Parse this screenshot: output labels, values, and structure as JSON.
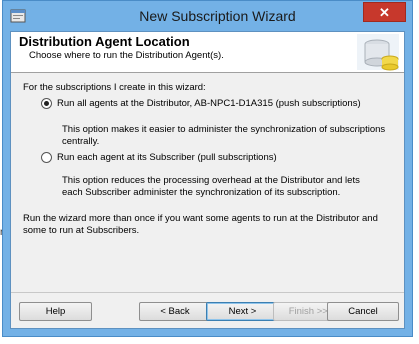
{
  "window": {
    "title": "New Subscription Wizard",
    "close_label": "✕"
  },
  "header": {
    "title": "Distribution Agent Location",
    "subtitle": "Choose where to run the Distribution Agent(s)."
  },
  "main": {
    "prompt": "For the subscriptions I create in this wizard:",
    "options": [
      {
        "label": "Run all agents at the Distributor, AB-NPC1-D1A315 (push subscriptions)",
        "selected": true,
        "description": "This option makes it easier to administer the synchronization of subscriptions centrally."
      },
      {
        "label": "Run each agent at its Subscriber (pull subscriptions)",
        "selected": false,
        "description": "This option reduces the processing overhead at the Distributor and lets each Subscriber administer the synchronization of its subscription."
      }
    ],
    "note": "Run the wizard more than once if you want some agents to run at the Distributor and some to run at Subscribers."
  },
  "buttons": {
    "help": "Help",
    "back": "< Back",
    "next": "Next >",
    "finish": "Finish >>|",
    "cancel": "Cancel"
  },
  "stray_text": "re"
}
